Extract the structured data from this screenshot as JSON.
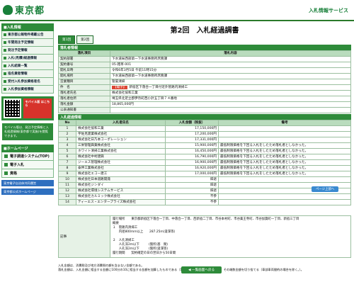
{
  "header": {
    "logo": "東京都",
    "service": "入札情報サービス"
  },
  "sidebar": {
    "menu_head": "■入札情報",
    "items": [
      {
        "label": "東京都公報物件掲載公告"
      },
      {
        "label": "年間発注予定情報"
      },
      {
        "label": "発注予定情報"
      },
      {
        "label": "入札(見積)経過情報"
      },
      {
        "label": "入札結果一覧"
      },
      {
        "label": "指名業者情報"
      },
      {
        "label": "受付入札参加資格者名"
      },
      {
        "label": "入札参加資格情報"
      }
    ],
    "qr_label": "モバイル版 はこちら",
    "mobile_text": "モバイル版は、発注予定情報と入札経過情報(東京都で実施)を閲覧できます。",
    "links_head": "■ホームページ",
    "links": [
      {
        "label": "電子調達システム(TOP)"
      },
      {
        "label": "電子入札"
      },
      {
        "label": "資格"
      }
    ],
    "ext_links": [
      {
        "label": "東京電子自治体共同運営"
      },
      {
        "label": "東京都公式ホームページ"
      }
    ]
  },
  "page": {
    "title": "第2回　入札経過調書",
    "tabs": [
      {
        "label": "第1回"
      },
      {
        "label": "第2回"
      }
    ],
    "info_head": "落札者情報",
    "info_cols": [
      "落札項目",
      "落札内容"
    ],
    "info_rows": [
      {
        "k": "契約部署",
        "v": "下水道局西部第一下水道事務所庶務課"
      },
      {
        "k": "契約番号",
        "v": "05-雑草-001"
      },
      {
        "k": "開札日時",
        "v": "令和6年3月5日 午前11時15分"
      },
      {
        "k": "開札場所",
        "v": "下水道局西部第一下水道事務所庶務課"
      },
      {
        "k": "営業種目",
        "v": "管渠清掃"
      },
      {
        "k": "件　名",
        "badge": "【電子】",
        "v": "新宿区下落合一丁目付近外管路内清掃工"
      },
      {
        "k": "落札者氏名",
        "v": "株式会社協和工業"
      },
      {
        "k": "落札者住所",
        "v": "埼玉県北足立郡伊奈町西小針五丁目７４番地"
      },
      {
        "k": "落札金額",
        "v": "18,865,000円"
      },
      {
        "k": "公表通知書",
        "v": ""
      }
    ],
    "bid_head": "入札経過情報",
    "bid_cols": [
      "No",
      "入札者氏名",
      "入札金額（税抜）",
      "備考"
    ],
    "bids": [
      {
        "no": "1",
        "name": "株式会社協和工業",
        "amt": "17,150,000円",
        "note": ""
      },
      {
        "no": "2",
        "name": "宇佐見建業株式会社",
        "amt": "17,200,000円",
        "note": ""
      },
      {
        "no": "3",
        "name": "株式会社日乃本コーポレーション",
        "amt": "17,331,000円",
        "note": ""
      },
      {
        "no": "4",
        "name": "三栄管理興業株式会社",
        "amt": "15,900,000円",
        "note": "最低制限価格を下回る入札をしたため落札者としなかった。"
      },
      {
        "no": "5",
        "name": "ホワイト清掃工業株式会社",
        "amt": "16,450,000円",
        "note": "最低制限価格を下回る入札をしたため落札者としなかった。"
      },
      {
        "no": "6",
        "name": "株式会社中村建興",
        "amt": "16,790,000円",
        "note": "最低制限価格を下回る入札をしたため落札者としなかった。"
      },
      {
        "no": "7",
        "name": "ジーエス管理株式会社",
        "amt": "16,900,000円",
        "note": "最低制限価格を下回る入札をしたため落札者としなかった。"
      },
      {
        "no": "8",
        "name": "泰伸工業株式会社",
        "amt": "16,920,000円",
        "note": "最低制限価格を下回る入札をしたため落札者としなかった。"
      },
      {
        "no": "9",
        "name": "株式会社エコー建工",
        "amt": "17,000,000円",
        "note": "最低制限価格を下回る入札をしたため落札者としなかった。"
      },
      {
        "no": "10",
        "name": "株式会社日本道路開発",
        "amt": "辞退",
        "note": ""
      },
      {
        "no": "11",
        "name": "株式会社ジンダイ",
        "amt": "辞退",
        "note": ""
      },
      {
        "no": "12",
        "name": "株式会社環境システムサービス",
        "amt": "辞退",
        "note": ""
      },
      {
        "no": "13",
        "name": "株式会社カルミック株式会社",
        "amt": "不参",
        "note": ""
      },
      {
        "no": "14",
        "name": "ティーエス・エンタープライズ株式会社",
        "amt": "不参",
        "note": ""
      }
    ],
    "scroll_btn": "ページ上部へ",
    "remarks_label": "記事",
    "remarks": "履行場所　　東京都新宿区下落合一丁目、中落合一丁目、西新宿二丁目、市谷本村町、市谷薬王寺町、市谷加賀町一丁目、新宿三丁目\n概要\n１　管路内清掃工\n　　内径800mm以上　　287.25m(浚渫等)\n\n２　人孔清掃工\n　　人孔深2m以下　　　(箇所(基　間)\n　　人孔深2m以下　　　(箇所(浚渫等)\n履行期間　　契約確定の日の翌日から50日間",
    "notes": "入札金額は、消費税及び地方消費税の額を含まない金額である。\n落札金額は、入札金額に相当する金額に100分の10に相当する金額を加算したものである（1円未満の端数が生じたときは、その端数金額を切り捨てる（車部車両間約の場合を除く。）。",
    "back_btn": "◀ 一覧画面へ戻る"
  }
}
